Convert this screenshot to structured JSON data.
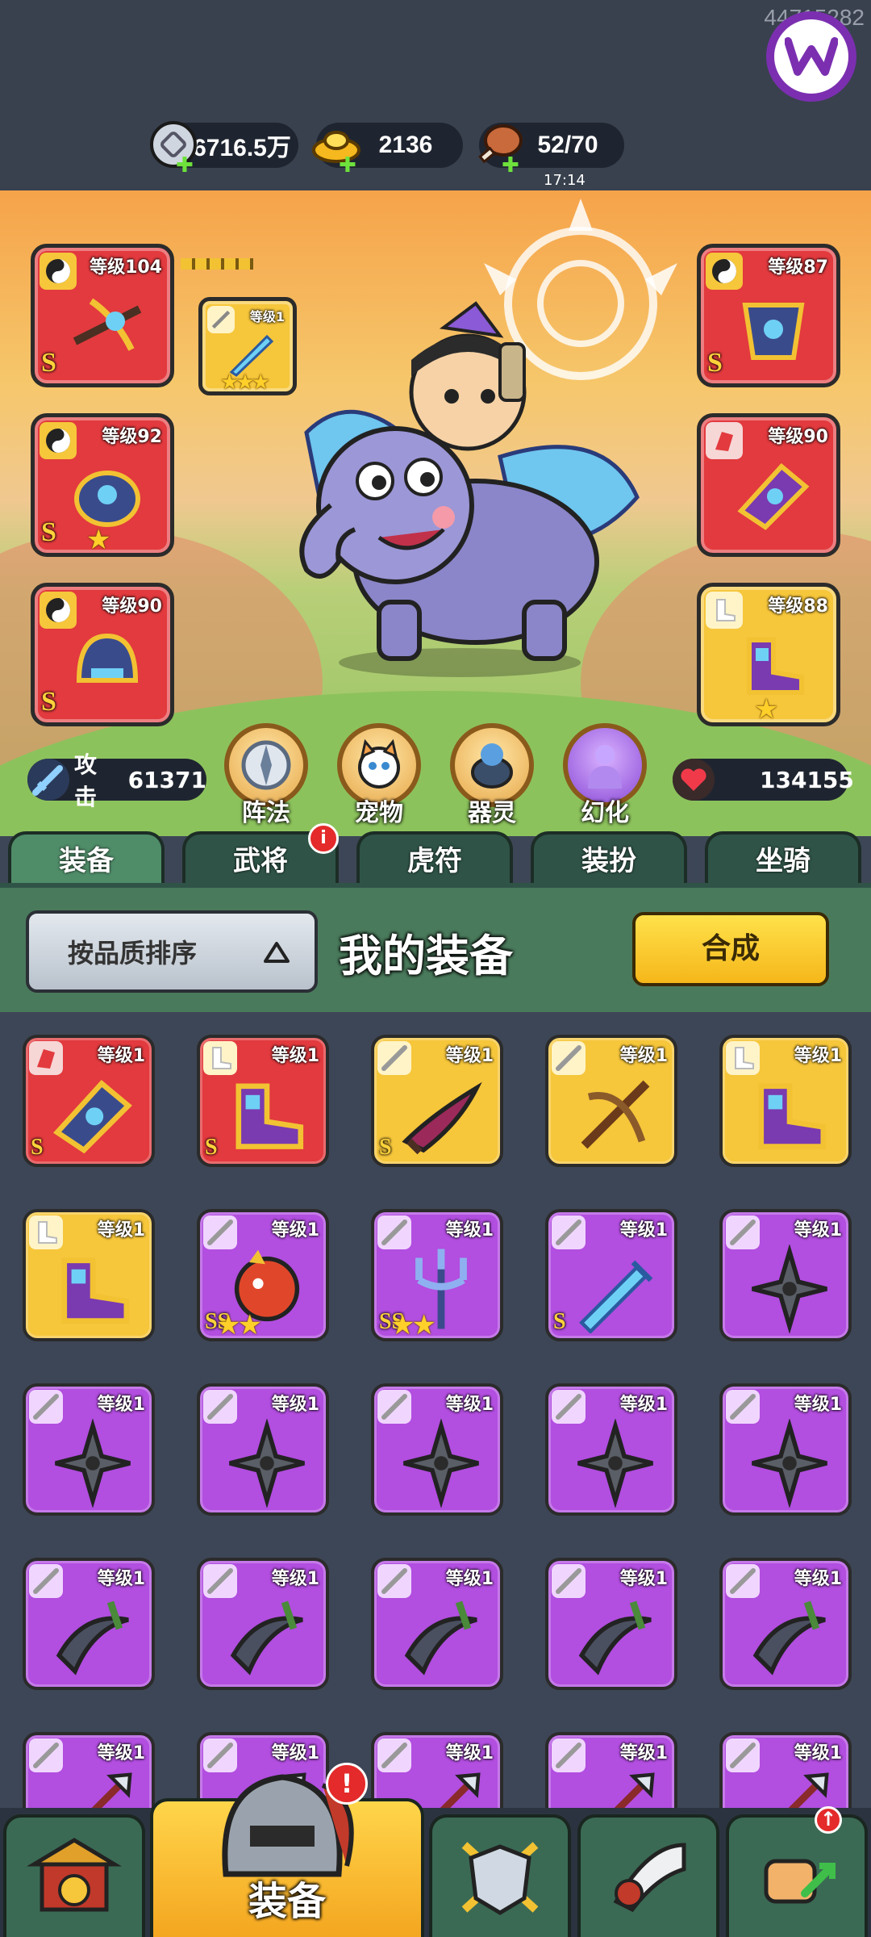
{
  "topbar": {
    "watermark": "44715282",
    "resources": [
      {
        "name": "silver",
        "value": "6716.5万",
        "icon": "silver-coin-icon"
      },
      {
        "name": "gold",
        "value": "2136",
        "icon": "gold-ingot-icon"
      },
      {
        "name": "stamina",
        "value": "52/70",
        "icon": "meat-drumstick-icon",
        "timer": "17:14"
      }
    ]
  },
  "equipped": {
    "left": [
      {
        "level": "等级104",
        "grade": "S",
        "rarity": "red",
        "type": "yin-yang-icon"
      },
      {
        "level": "等级92",
        "grade": "S",
        "rarity": "red",
        "type": "yin-yang-icon",
        "stars": 1
      },
      {
        "level": "等级90",
        "grade": "S",
        "rarity": "red",
        "type": "yin-yang-icon"
      }
    ],
    "right": [
      {
        "level": "等级87",
        "grade": "S",
        "rarity": "red",
        "type": "yin-yang-icon"
      },
      {
        "level": "等级90",
        "grade": "",
        "rarity": "red",
        "type": "gauntlet-icon"
      },
      {
        "level": "等级88",
        "grade": "",
        "rarity": "gold",
        "type": "boot-icon",
        "stars": 1
      }
    ],
    "weapon_slot": {
      "level": "等级1",
      "stars": 3
    }
  },
  "stats": {
    "attack_label": "攻击",
    "attack_value": "61371",
    "hp_value": "134155"
  },
  "sub_buttons": [
    "阵法",
    "宠物",
    "器灵",
    "幻化"
  ],
  "tabs": [
    "装备",
    "武将",
    "虎符",
    "装扮",
    "坐骑"
  ],
  "tab_badge": "i",
  "panel": {
    "sort_label": "按品质排序",
    "title": "我的装备",
    "merge_label": "合成"
  },
  "grid": [
    {
      "rarity": "red",
      "level": "等级1",
      "grade": "S",
      "type": "gauntlet-icon",
      "art": "bracer"
    },
    {
      "rarity": "red",
      "level": "等级1",
      "grade": "S",
      "type": "boot-icon",
      "art": "boots"
    },
    {
      "rarity": "gold",
      "level": "等级1",
      "grade": "S",
      "type": "sword-icon",
      "art": "blade"
    },
    {
      "rarity": "gold",
      "level": "等级1",
      "grade": "",
      "type": "sword-icon",
      "art": "crossbow"
    },
    {
      "rarity": "gold",
      "level": "等级1",
      "grade": "",
      "type": "boot-icon",
      "art": "boots"
    },
    {
      "rarity": "gold",
      "level": "等级1",
      "grade": "",
      "type": "boot-icon",
      "art": "boots"
    },
    {
      "rarity": "purple",
      "level": "等级1",
      "grade": "SS",
      "type": "sword-icon",
      "art": "dragon",
      "stars": 2
    },
    {
      "rarity": "purple",
      "level": "等级1",
      "grade": "SS",
      "type": "sword-icon",
      "art": "trident",
      "stars": 2
    },
    {
      "rarity": "purple",
      "level": "等级1",
      "grade": "S",
      "type": "sword-icon",
      "art": "icesword"
    },
    {
      "rarity": "purple",
      "level": "等级1",
      "grade": "",
      "type": "sword-icon",
      "art": "shuriken"
    },
    {
      "rarity": "purple",
      "level": "等级1",
      "grade": "",
      "type": "sword-icon",
      "art": "shuriken"
    },
    {
      "rarity": "purple",
      "level": "等级1",
      "grade": "",
      "type": "sword-icon",
      "art": "shuriken"
    },
    {
      "rarity": "purple",
      "level": "等级1",
      "grade": "",
      "type": "sword-icon",
      "art": "shuriken"
    },
    {
      "rarity": "purple",
      "level": "等级1",
      "grade": "",
      "type": "sword-icon",
      "art": "shuriken"
    },
    {
      "rarity": "purple",
      "level": "等级1",
      "grade": "",
      "type": "sword-icon",
      "art": "shuriken"
    },
    {
      "rarity": "purple",
      "level": "等级1",
      "grade": "",
      "type": "sword-icon",
      "art": "sickle"
    },
    {
      "rarity": "purple",
      "level": "等级1",
      "grade": "",
      "type": "sword-icon",
      "art": "sickle"
    },
    {
      "rarity": "purple",
      "level": "等级1",
      "grade": "",
      "type": "sword-icon",
      "art": "sickle"
    },
    {
      "rarity": "purple",
      "level": "等级1",
      "grade": "",
      "type": "sword-icon",
      "art": "sickle"
    },
    {
      "rarity": "purple",
      "level": "等级1",
      "grade": "",
      "type": "sword-icon",
      "art": "sickle"
    },
    {
      "rarity": "purple",
      "level": "等级1",
      "grade": "",
      "type": "sword-icon",
      "art": "spear"
    },
    {
      "rarity": "purple",
      "level": "等级1",
      "grade": "",
      "type": "sword-icon",
      "art": "spear"
    },
    {
      "rarity": "purple",
      "level": "等级1",
      "grade": "",
      "type": "sword-icon",
      "art": "spear"
    },
    {
      "rarity": "purple",
      "level": "等级1",
      "grade": "",
      "type": "sword-icon",
      "art": "spear"
    },
    {
      "rarity": "purple",
      "level": "等级1",
      "grade": "",
      "type": "sword-icon",
      "art": "spear"
    }
  ],
  "bottom_nav": [
    {
      "icon": "city-gate-icon",
      "label": ""
    },
    {
      "icon": "helmet-icon",
      "label": "装备",
      "badge": "!"
    },
    {
      "icon": "shield-swords-icon",
      "label": ""
    },
    {
      "icon": "war-horn-icon",
      "label": ""
    },
    {
      "icon": "fist-upgrade-icon",
      "label": ""
    }
  ],
  "colors": {
    "red_rarity": "#e23a3e",
    "gold_rarity": "#f6c63b",
    "purple_rarity": "#b24ee0",
    "tab_green": "#4f8c68"
  }
}
